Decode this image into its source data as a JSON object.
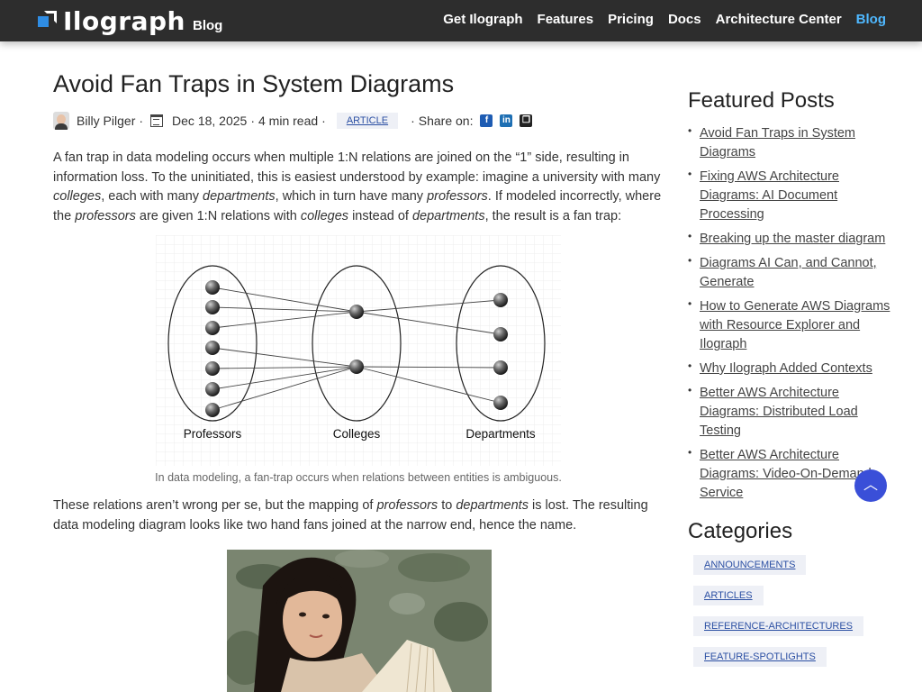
{
  "header": {
    "brand": "Ilograph",
    "brand_sub": "Blog",
    "nav": [
      {
        "label": "Get Ilograph",
        "active": false
      },
      {
        "label": "Features",
        "active": false
      },
      {
        "label": "Pricing",
        "active": false
      },
      {
        "label": "Docs",
        "active": false
      },
      {
        "label": "Architecture Center",
        "active": false
      },
      {
        "label": "Blog",
        "active": true
      }
    ]
  },
  "article": {
    "title": "Avoid Fan Traps in System Diagrams",
    "author": "Billy Pilger",
    "date": "Dec 18, 2025",
    "read_time": "4 min read",
    "tag": "ARTICLE",
    "share_label": "Share on:",
    "p1_a": "A fan trap in data modeling occurs when multiple 1:N relations are joined on the “1” side, resulting in information loss. To the uninitiated, this is easiest understood by example: imagine a university with many ",
    "p1_colleges": "colleges",
    "p1_b": ", each with many ",
    "p1_departments": "departments",
    "p1_c": ", which in turn have many ",
    "p1_professors": "professors",
    "p1_d": ". If modeled incorrectly, where the ",
    "p1_professors2": "professors",
    "p1_e": " are given 1:N relations with ",
    "p1_colleges2": "colleges",
    "p1_f": " instead of ",
    "p1_departments2": "departments",
    "p1_g": ", the result is a fan trap:",
    "figure_labels": {
      "left": "Professors",
      "middle": "Colleges",
      "right": "Departments"
    },
    "caption": "In data modeling, a fan-trap occurs when relations between entities is ambiguous.",
    "p2_a": "These relations aren’t wrong per se, but the mapping of ",
    "p2_professors": "professors",
    "p2_b": " to ",
    "p2_departments": "departments",
    "p2_c": " is lost. The resulting data modeling diagram looks like two hand fans joined at the narrow end, hence the name."
  },
  "sidebar": {
    "featured_title": "Featured Posts",
    "posts": [
      "Avoid Fan Traps in System Diagrams",
      "Fixing AWS Architecture Diagrams: AI Document Processing",
      "Breaking up the master diagram",
      "Diagrams AI Can, and Cannot, Generate",
      "How to Generate AWS Diagrams with Resource Explorer and Ilograph",
      "Why Ilograph Added Contexts",
      "Better AWS Architecture Diagrams: Distributed Load Testing",
      "Better AWS Architecture Diagrams: Video-On-Demand Service"
    ],
    "categories_title": "Categories",
    "categories": [
      "ANNOUNCEMENTS",
      "ARTICLES",
      "REFERENCE-ARCHITECTURES",
      "FEATURE-SPOTLIGHTS"
    ]
  },
  "colors": {
    "nav_bg": "#2d2d2d",
    "nav_active": "#4fb8ff",
    "tag_bg": "#eef0f6",
    "link": "#2b4fa3",
    "scroll_button": "#3a4fd8"
  },
  "icons": [
    "logo-icon",
    "calendar-icon",
    "facebook-icon",
    "linkedin-icon",
    "copy-icon",
    "arrow-up-icon"
  ]
}
